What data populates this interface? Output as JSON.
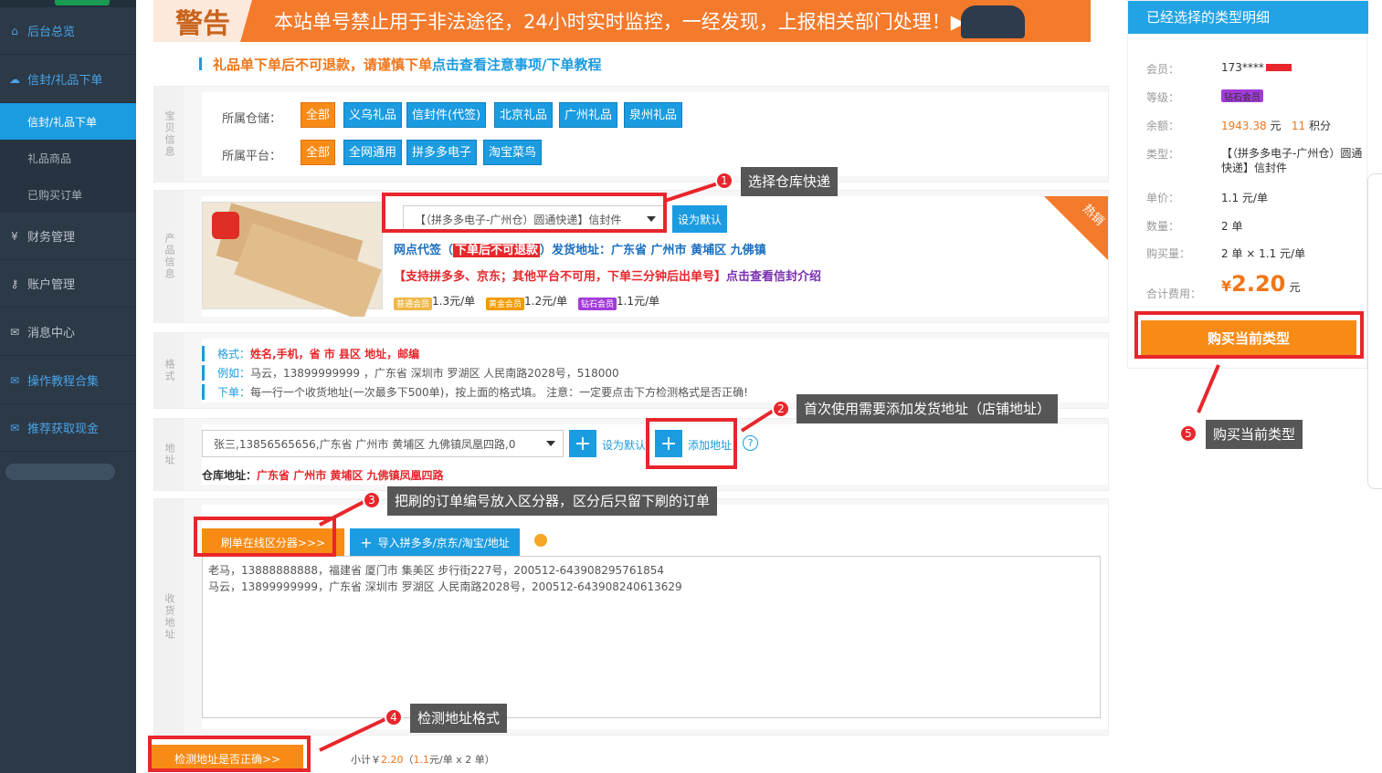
{
  "sidebar": {
    "items": [
      {
        "label": "后台总览",
        "icon": "home-icon"
      },
      {
        "label": "信封/礼品下单",
        "icon": "cloud-icon"
      },
      {
        "label": "财务管理",
        "icon": "yen-icon"
      },
      {
        "label": "账户管理",
        "icon": "key-icon"
      },
      {
        "label": "消息中心",
        "icon": "mail-icon"
      },
      {
        "label": "操作教程合集",
        "icon": "mail-icon"
      },
      {
        "label": "推荐获取现金",
        "icon": "mail-icon"
      }
    ],
    "subitems": [
      "信封/礼品下单",
      "礼品商品",
      "已购买订单"
    ]
  },
  "banner": {
    "logo": "警告",
    "text": "本站单号禁止用于非法途径，24小时实时监控，一经发现，上报相关部门处理！▶"
  },
  "notice": {
    "text": "礼品单下单后不可退款，请谨慎下单",
    "link": "点击查看注意事项/下单教程"
  },
  "shop": {
    "vlabel": "宝贝信息",
    "warehouse_label": "所属仓储：",
    "warehouses": [
      "全部",
      "义乌礼品",
      "信封件(代签)",
      "北京礼品",
      "广州礼品",
      "泉州礼品"
    ],
    "platform_label": "所属平台：",
    "platforms": [
      "全部",
      "全网通用",
      "拼多多电子",
      "淘宝菜鸟"
    ]
  },
  "product": {
    "vlabel": "产品信息",
    "select_value": "【（拼多多电子-广州仓）圆通快递】信封件",
    "default_btn": "设为默认",
    "hot": "热销",
    "line1_a": "网点代签（",
    "line1_red": "下单后不可退款",
    "line1_b": "）发货地址：广东省 广州市 黄埔区 九佛镇",
    "line2": "【支持拼多多、京东；其他平台不可用，下单三分钟后出单号】",
    "line2_link": "点击查看信封介绍",
    "prices": [
      {
        "badge": "普通会员",
        "price": "1.3元/单"
      },
      {
        "badge": "黄金会员",
        "price": "1.2元/单"
      },
      {
        "badge": "钻石会员",
        "price": "1.1元/单"
      }
    ]
  },
  "format": {
    "vlabel": "格式",
    "rows": [
      {
        "k": "格式：",
        "v": "姓名,手机，省 市 县区 地址，邮编"
      },
      {
        "k": "例如：",
        "v": "马云，13899999999 ，广东省 深圳市 罗湖区 人民南路2028号，518000"
      },
      {
        "k": "下单：",
        "v": "每一行一个收货地址(一次最多下500单)，按上面的格式填。 注意：一定要点击下方检测格式是否正确!"
      }
    ]
  },
  "address": {
    "vlabel": "地址",
    "select_value": "张三,13856565656,广东省 广州市 黄埔区 九佛镇凤凰四路,0",
    "default_btn": "设为默认",
    "add_btn": "添加地址",
    "warehouse_label": "仓库地址：",
    "warehouse_value": "广东省 广州市 黄埔区 九佛镇凤凰四路"
  },
  "receiver": {
    "vlabel": "收货地址",
    "splitter_btn": "刷单在线区分器>>>",
    "import_btn": "导入拼多多/京东/淘宝/地址",
    "lines": [
      "老马，13888888888，福建省 厦门市 集美区 步行街227号，200512-643908295761854",
      "马云，13899999999，广东省 深圳市 罗湖区 人民南路2028号，200512-643908240613629"
    ],
    "check_btn": "检测地址是否正确>>",
    "subtotal_prefix": "小计￥",
    "subtotal": "2.20",
    "subtotal_open": "（",
    "subtotal_unit": "1.1",
    "subtotal_rest": "元/单 x 2 单）"
  },
  "callouts": [
    {
      "n": "1",
      "text": "选择仓库快递"
    },
    {
      "n": "2",
      "text": "首次使用需要添加发货地址（店铺地址）"
    },
    {
      "n": "3",
      "text": "把刷的订单编号放入区分器，区分后只留下刷的订单"
    },
    {
      "n": "4",
      "text": "检测地址格式"
    },
    {
      "n": "5",
      "text": "购买当前类型"
    }
  ],
  "summary": {
    "title": "已经选择的类型明细",
    "member_k": "会员：",
    "member_v": "173****",
    "level_k": "等级：",
    "level_v": "钻石会员",
    "balance_k": "余额：",
    "balance_v": "1943.38",
    "balance_unit": "元",
    "points": "11",
    "points_unit": "积分",
    "type_k": "类型：",
    "type_v": "【（拼多多电子-广州仓）圆通快递】信封件",
    "unit_k": "单价：",
    "unit_v": "1.1 元/单",
    "qty_k": "数量：",
    "qty_v": "2 单",
    "buy_k": "购买量：",
    "buy_v": "2 单 × 1.1 元/单",
    "total_k": "合计费用：",
    "total_currency": "¥",
    "total_v": "2.20",
    "total_unit": "元",
    "buy_btn": "购买当前类型"
  },
  "colors": {
    "accent": "#1b9be0",
    "orange": "#f88b15",
    "red": "#e8262b",
    "sidebar": "#2c3947"
  }
}
